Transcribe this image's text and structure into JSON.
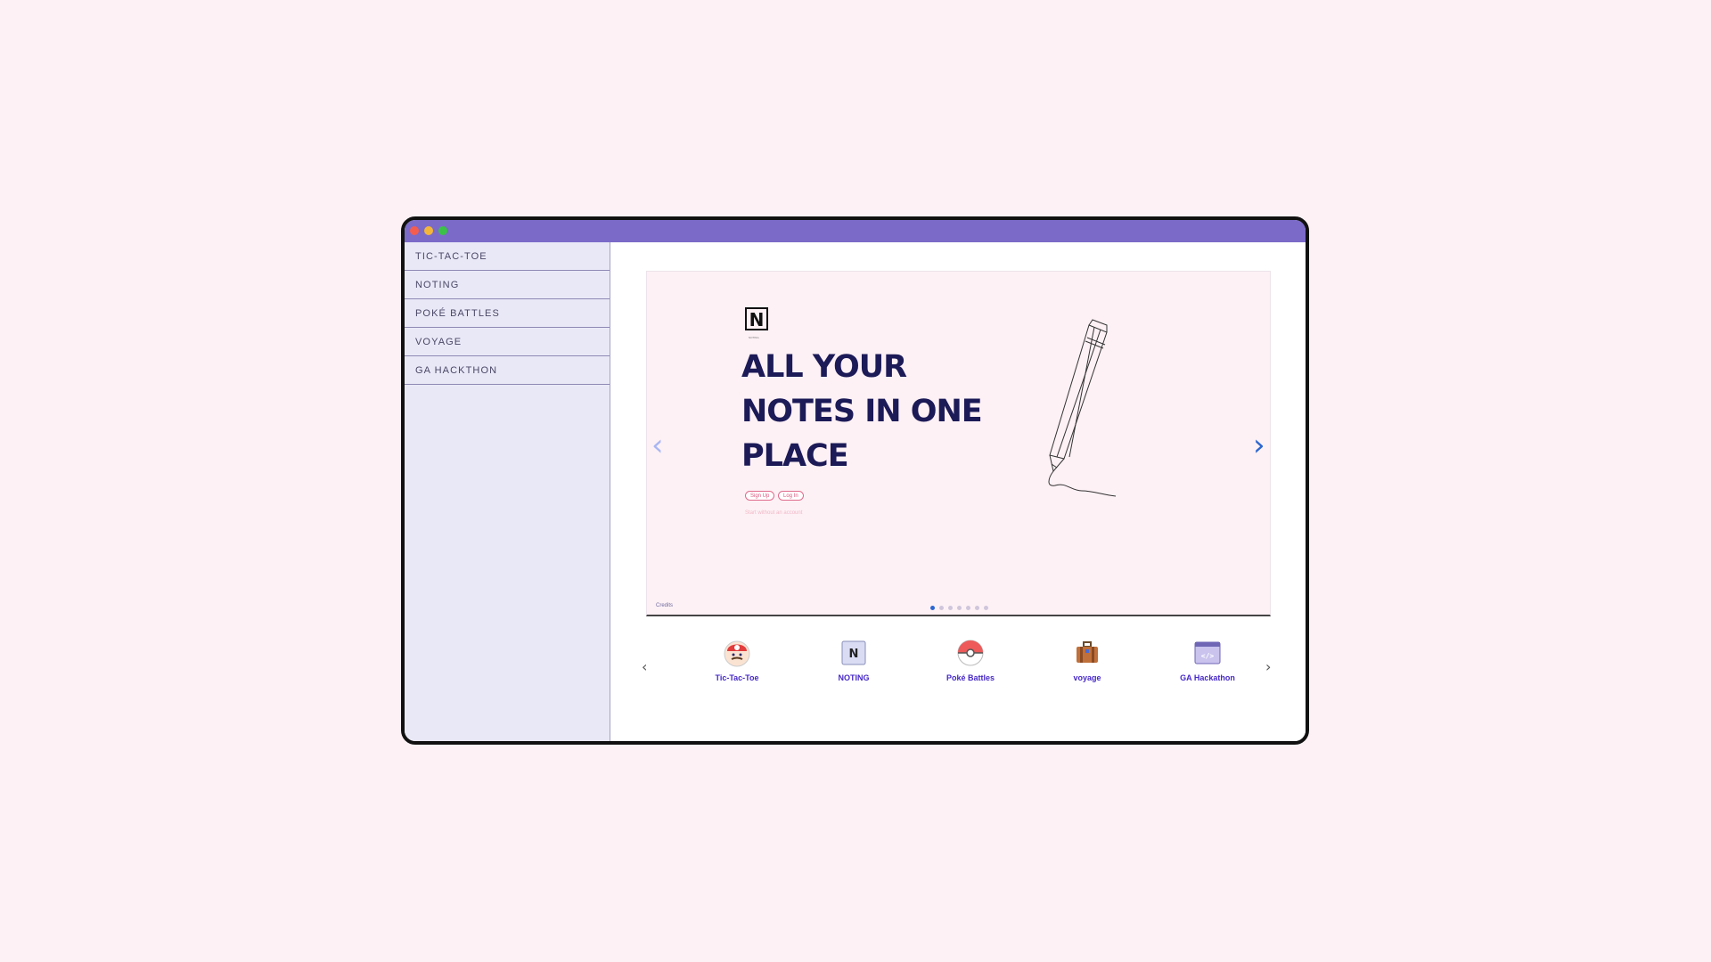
{
  "sidebar": {
    "items": [
      {
        "label": "TIC-TAC-TOE"
      },
      {
        "label": "NOTING"
      },
      {
        "label": "POKÉ BATTLES"
      },
      {
        "label": "VOYAGE"
      },
      {
        "label": "GA HACKTHON"
      }
    ]
  },
  "hero": {
    "logo_letter": "N",
    "logo_caption": "NOTING",
    "headline": "ALL YOUR NOTES IN ONE PLACE",
    "signup_label": "Sign Up",
    "login_label": "Log In",
    "guest_label": "Start without an account",
    "credits_label": "Credits",
    "prev_arrow": "‹",
    "next_arrow": "›",
    "slide_count": 7,
    "active_slide": 1
  },
  "projects": {
    "prev_arrow": "‹",
    "next_arrow": "›",
    "items": [
      {
        "label": "Tic-Tac-Toe",
        "icon": "mario-icon"
      },
      {
        "label": "NOTING",
        "icon": "noting-n-icon"
      },
      {
        "label": "Poké Battles",
        "icon": "pokeball-icon"
      },
      {
        "label": "voyage",
        "icon": "suitcase-icon"
      },
      {
        "label": "GA Hackathon",
        "icon": "code-window-icon"
      }
    ]
  },
  "colors": {
    "page_bg": "#fdf1f5",
    "titlebar": "#7b6ac8",
    "sidebar_bg": "#e9e8f7",
    "headline": "#1c1a57",
    "accent_blue": "#2c67d1",
    "project_label": "#4628c8"
  }
}
